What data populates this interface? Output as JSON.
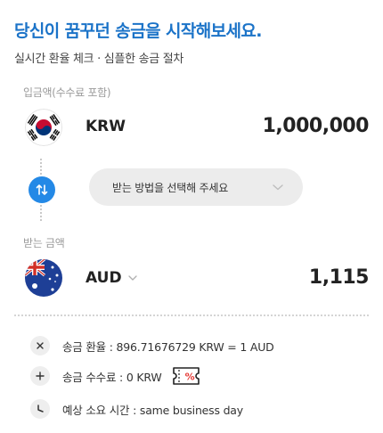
{
  "header": {
    "title": "당신이 꿈꾸던 송금을 시작해보세요.",
    "subtitle": "실시간 환율 체크 · 심플한 송금 절차"
  },
  "send": {
    "label": "입금액(수수료 포함)",
    "flag": "south-korea-flag",
    "currency": "KRW",
    "amount": "1,000,000"
  },
  "method": {
    "placeholder": "받는 방법을 선택해 주세요",
    "swap_icon": "swap-vertical-icon"
  },
  "receive": {
    "label": "받는 금액",
    "flag": "australia-flag",
    "currency": "AUD",
    "amount": "1,115"
  },
  "info": {
    "rate": "송금 환율 : 896.71676729 KRW = 1 AUD",
    "fee": "송금 수수료 : 0 KRW",
    "time": "예상 소요 시간 : same business day"
  },
  "colors": {
    "accent": "#1b73c8",
    "button": "#2489e6",
    "coupon": "#e53935"
  }
}
